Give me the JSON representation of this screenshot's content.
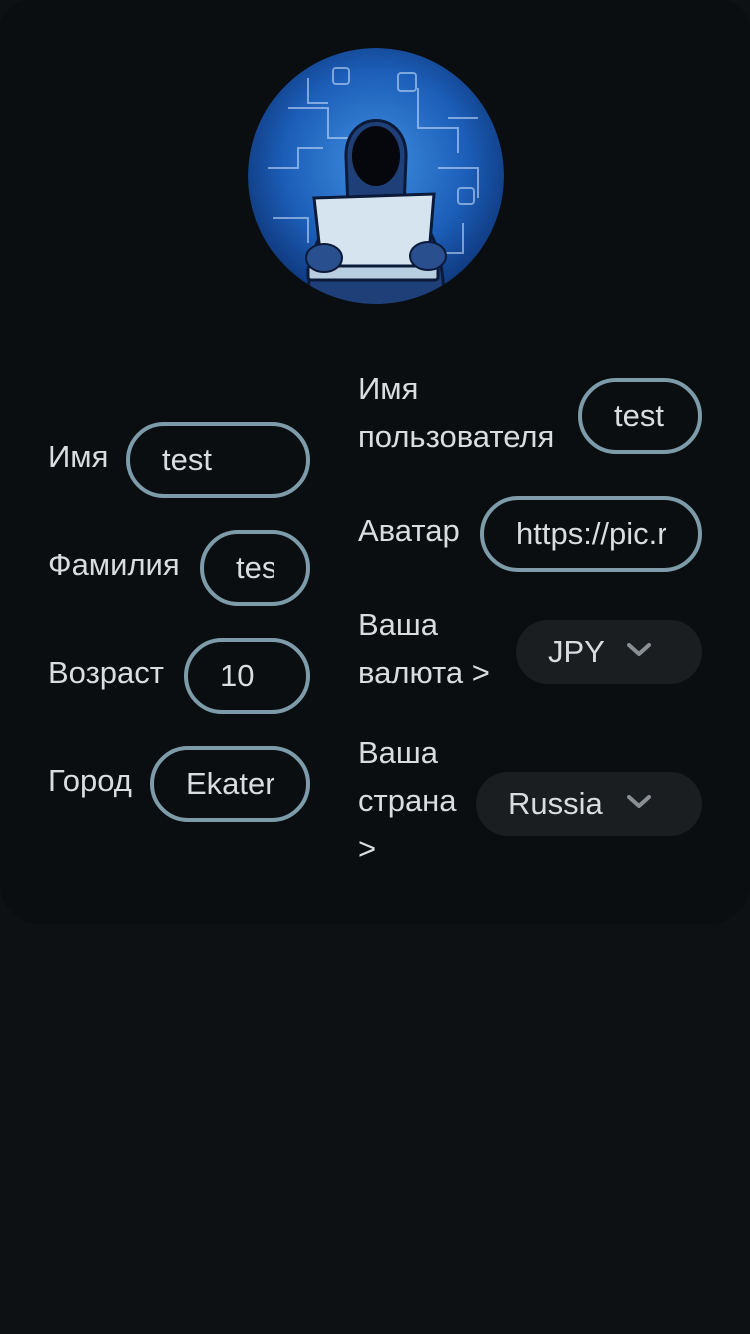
{
  "profile": {
    "first_name": {
      "label": "Имя",
      "value": "test"
    },
    "last_name": {
      "label": "Фамилия",
      "value": "test"
    },
    "age": {
      "label": "Возраст",
      "value": "10"
    },
    "city": {
      "label": "Город",
      "value": "Ekaterinburg"
    },
    "username": {
      "label_line1": "Имя",
      "label_line2": "пользователя",
      "value": "test"
    },
    "avatar": {
      "label": "Аватар",
      "value": "https://pic.r"
    },
    "currency": {
      "label_line1": "Ваша",
      "label_line2": "валюта >",
      "value": "JPY"
    },
    "country": {
      "label_line1": "Ваша",
      "label_line2": "страна",
      "label_line3": ">",
      "value": "Russia"
    }
  },
  "icons": {
    "avatar": "hooded-hacker-avatar",
    "dropdown": "chevron-down-icon"
  },
  "colors": {
    "background": "#0d1114",
    "card": "#0a0e11",
    "input_border": "#7d9ba8",
    "select_bg": "#1a1e21",
    "text": "#d9dde0"
  }
}
